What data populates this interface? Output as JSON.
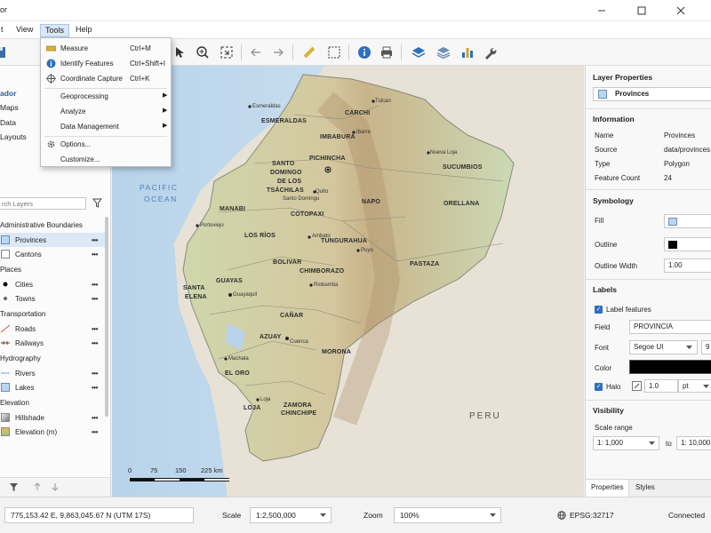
{
  "window": {
    "title_fragment": "or"
  },
  "menu": {
    "items": [
      "t",
      "View",
      "Tools",
      "Help"
    ],
    "active": "Tools"
  },
  "tools_menu": {
    "items": [
      {
        "label": "Measure",
        "shortcut": "Ctrl+M",
        "icon": "ruler-icon"
      },
      {
        "label": "Identify Features",
        "shortcut": "Ctrl+Shift+I",
        "icon": "info-icon"
      },
      {
        "label": "Coordinate Capture",
        "shortcut": "Ctrl+K",
        "icon": "crosshair-icon"
      },
      {
        "label": "Geoprocessing",
        "submenu": true
      },
      {
        "label": "Analyze",
        "submenu": true
      },
      {
        "label": "Data Management",
        "submenu": true
      },
      {
        "label": "Options...",
        "icon": "gear-icon"
      },
      {
        "label": "Customize..."
      }
    ]
  },
  "left_panel": {
    "project_items": [
      "ador",
      "Maps",
      "Data",
      "Layouts"
    ],
    "search_placeholder": "rch Layers",
    "groups": {
      "admin": "Administrative Boundaries",
      "places": "Places",
      "transport": "Transportation",
      "hydro": "Hydrography",
      "elev": "Elevation"
    },
    "layers": {
      "provinces": "Provinces",
      "cantons": "Cantons",
      "cities": "Cities",
      "towns": "Towns",
      "roads": "Roads",
      "railways": "Railways",
      "rivers": "Rivers",
      "lakes": "Lakes",
      "hillshade": "Hillshade",
      "elevation": "Elevation (m)"
    },
    "more": "•••"
  },
  "map": {
    "provinces": [
      "ESMERALDAS",
      "CARCHI",
      "IMBABURA",
      "PICHINCHA",
      "SUCUMBIOS",
      "SANTO",
      "DOMINGO",
      "DE LOS",
      "TSÁCHILAS",
      "MANABI",
      "NAPO",
      "ORELLANA",
      "COTOPAXI",
      "LOS RÍOS",
      "TUNGURAHUA",
      "BOLIVAR",
      "PASTAZA",
      "CHIMBORAZO",
      "GUAYAS",
      "SANTA",
      "ELENA",
      "CAÑAR",
      "AZUAY",
      "EL ORO",
      "MORONA",
      "LOJA",
      "ZAMORA",
      "CHINCHIPE"
    ],
    "cities": [
      "Esmeraldas",
      "Tulcan",
      "Ibarra",
      "Quito",
      "Nueva Loja",
      "Santo Domingo",
      "Portoviejo",
      "Ambato",
      "Puyo",
      "Riobamba",
      "Guayaquil",
      "Cuenca",
      "Machala",
      "Loja"
    ],
    "ocean": [
      "PACIFIC",
      "OCEAN"
    ],
    "country": "PERU",
    "scale": {
      "ticks": [
        "0",
        "75",
        "150",
        "225 km"
      ]
    }
  },
  "right_panel": {
    "title": "Layer Properties",
    "selected_layer": "Provinces",
    "information": {
      "heading": "Information",
      "rows": [
        {
          "key": "Name",
          "value": "Provinces"
        },
        {
          "key": "Source",
          "value": "data/provinces.s"
        },
        {
          "key": "Type",
          "value": "Polygon"
        },
        {
          "key": "Feature Count",
          "value": "24"
        }
      ]
    },
    "symbology": {
      "heading": "Symbology",
      "fill_label": "Fill",
      "outline_label": "Outline",
      "outline_width_label": "Outline Width",
      "outline_width": "1.00",
      "fill_color": "#bcd6ef",
      "outline_color": "#000000"
    },
    "labels": {
      "heading": "Labels",
      "enable_label": "Label features",
      "field_label": "Field",
      "field_value": "PROVINCIA",
      "font_label": "Font",
      "font_value": "Segoe UI",
      "font_size": "9",
      "color_label": "Color",
      "halo_label": "Halo",
      "halo_value": "1.0",
      "halo_unit": "pt"
    },
    "visibility": {
      "heading": "Visibility",
      "scale_range_label": "Scale range",
      "min": "1:  1,000",
      "to": "to",
      "max": "1:  10,000,"
    },
    "tabs": [
      "Properties",
      "Styles"
    ]
  },
  "status": {
    "coords": "775,153.42 E,    9,863,045.67 N   (UTM 17S)",
    "scale_label": "Scale",
    "scale_value": "1:2,500,000",
    "zoom_label": "Zoom",
    "zoom_value": "100%",
    "epsg": "EPSG:32717",
    "connection": "Connected"
  }
}
